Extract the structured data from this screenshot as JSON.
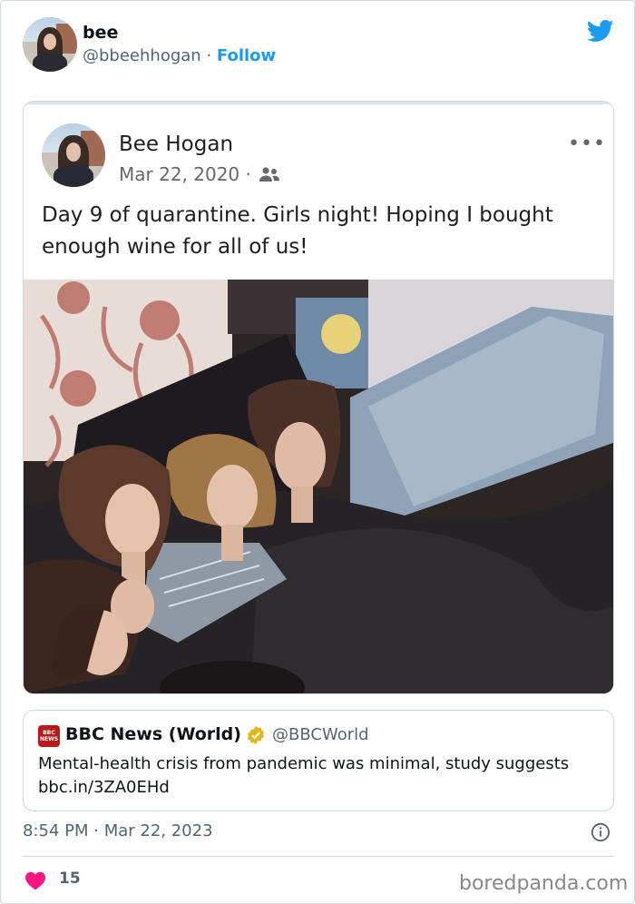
{
  "tweet": {
    "author_name": "bee",
    "author_handle": "@bbeehhogan",
    "separator": "·",
    "follow_label": "Follow",
    "timestamp": "8:54 PM · Mar 22, 2023",
    "like_count": "15"
  },
  "embedded_post": {
    "name": "Bee Hogan",
    "date": "Mar 22, 2020 ·",
    "more_glyph": "•••",
    "text": "Day 9 of quarantine. Girls night! Hoping I bought enough wine for all of us!"
  },
  "quoted_tweet": {
    "logo_text": "BBC NEWS",
    "name": "BBC News (World)",
    "handle": "@BBCWorld",
    "text": "Mental-health crisis from pandemic was minimal, study suggests",
    "link": "bbc.in/3ZA0EHd"
  },
  "watermark": "boredpanda.com",
  "icons": {
    "brand": "twitter-bird-icon",
    "audience": "friends-icon",
    "verified": "verified-badge-icon",
    "info": "info-icon",
    "like": "heart-icon"
  },
  "colors": {
    "accent": "#1d9bf0",
    "like": "#f91880",
    "bbc": "#bb1919",
    "verified": "#e2b719",
    "muted": "#536471"
  }
}
